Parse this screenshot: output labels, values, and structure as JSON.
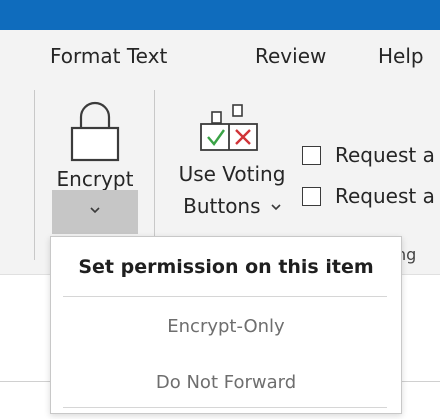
{
  "ribbon": {
    "tabs": [
      {
        "label": "Format Text"
      },
      {
        "label": "Review"
      },
      {
        "label": "Help"
      }
    ],
    "encrypt": {
      "label": "Encrypt",
      "icon": "lock-icon",
      "dropdown_icon": "chevron-down-icon"
    },
    "voting": {
      "label_line1": "Use Voting",
      "label_line2": "Buttons",
      "icon": "voting-buttons-icon",
      "dropdown_icon": "chevron-down-icon"
    },
    "checkboxes": [
      {
        "label": "Request a",
        "checked": false
      },
      {
        "label": "Request a",
        "checked": false
      }
    ],
    "group_label_fragment": "ng"
  },
  "encrypt_menu": {
    "header": "Set permission on this item",
    "items": [
      {
        "label": "Encrypt-Only"
      },
      {
        "label": "Do Not Forward"
      }
    ]
  },
  "colors": {
    "titlebar": "#0f6cbd",
    "ribbon_bg": "#f3f3f3",
    "pressed_button": "#c6c6c6",
    "check_green": "#3aa346",
    "cross_red": "#d13438"
  }
}
